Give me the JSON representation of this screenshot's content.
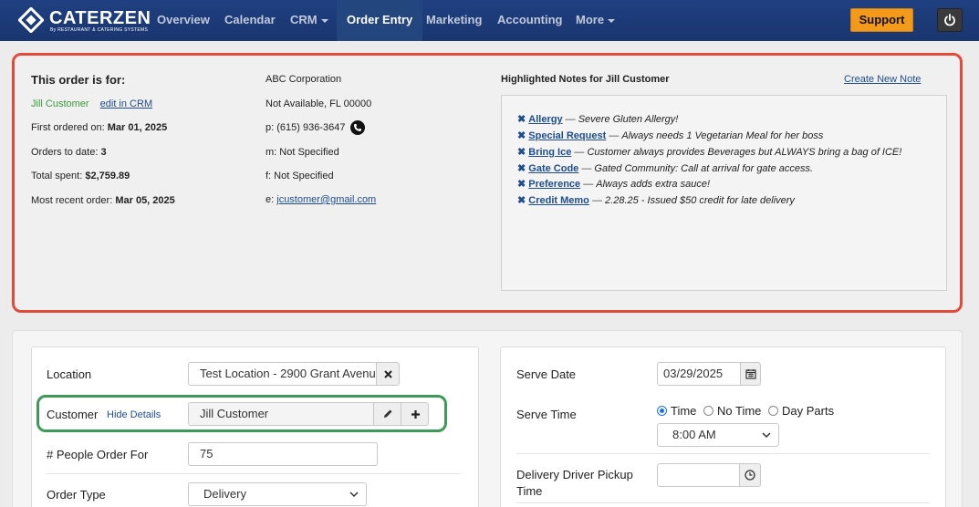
{
  "brand": {
    "name": "CATERZEN",
    "subtitle": "By RESTAURANT & CATERING SYSTEMS"
  },
  "nav": {
    "items": [
      {
        "label": "Overview"
      },
      {
        "label": "Calendar"
      },
      {
        "label": "CRM"
      },
      {
        "label": "Order Entry"
      },
      {
        "label": "Marketing"
      },
      {
        "label": "Accounting"
      },
      {
        "label": "More"
      }
    ],
    "active": "Order Entry",
    "support_label": "Support"
  },
  "order_for": {
    "title": "This order is for:",
    "customer_name": "Jill Customer",
    "edit_link": "edit in CRM",
    "first_ordered_label": "First ordered on:",
    "first_ordered_value": "Mar 01, 2025",
    "orders_to_date_label": "Orders to date:",
    "orders_to_date_value": "3",
    "total_spent_label": "Total spent:",
    "total_spent_value": "$2,759.89",
    "most_recent_label": "Most recent order:",
    "most_recent_value": "Mar 05, 2025",
    "company": "ABC Corporation",
    "address": "Not Available, FL 00000",
    "phone": "p: (615) 936-3647",
    "mobile": "m: Not Specified",
    "fax": "f: Not Specified",
    "email_prefix": "e:",
    "email": "jcustomer@gmail.com"
  },
  "notes": {
    "title": "Highlighted Notes for Jill Customer",
    "create_link": "Create New Note",
    "items": [
      {
        "x": "✖",
        "label": "Allergy",
        "sep": "—",
        "text": "Severe Gluten Allergy!"
      },
      {
        "x": "✖",
        "label": "Special Request",
        "sep": "—",
        "text": "Always needs 1 Vegetarian Meal for her boss"
      },
      {
        "x": "✖",
        "label": "Bring Ice",
        "sep": "—",
        "text": "Customer always provides Beverages but ALWAYS bring a bag of ICE!"
      },
      {
        "x": "✖",
        "label": "Gate Code",
        "sep": "—",
        "text": "Gated Community: Call at arrival for gate access."
      },
      {
        "x": "✖",
        "label": "Preference",
        "sep": "—",
        "text": "Always adds extra sauce!"
      },
      {
        "x": "✖",
        "label": "Credit Memo",
        "sep": "—",
        "text": "2.28.25 - Issued $50 credit for late delivery"
      }
    ]
  },
  "form_left": {
    "location_label": "Location",
    "location_value": "Test Location - 2900 Grant Avenu",
    "customer_label": "Customer",
    "hide_details": "Hide Details",
    "customer_value": "Jill Customer",
    "people_label": "# People Order For",
    "people_value": "75",
    "order_type_label": "Order Type",
    "order_type_value": "Delivery"
  },
  "form_right": {
    "serve_date_label": "Serve Date",
    "serve_date_value": "03/29/2025",
    "serve_time_label": "Serve Time",
    "time_options": [
      "Time",
      "No Time",
      "Day Parts"
    ],
    "time_selected": "Time",
    "serve_time_value": "8:00 AM",
    "pickup_label_line1": "Delivery Driver Pickup",
    "pickup_label_line2": "Time",
    "pickup_value": ""
  },
  "colors": {
    "nav_bg": "#1f3f80",
    "support": "#f39a1b",
    "highlight_red": "#e04b3c",
    "highlight_green": "#3f9a59",
    "link": "#1f4d8c"
  }
}
